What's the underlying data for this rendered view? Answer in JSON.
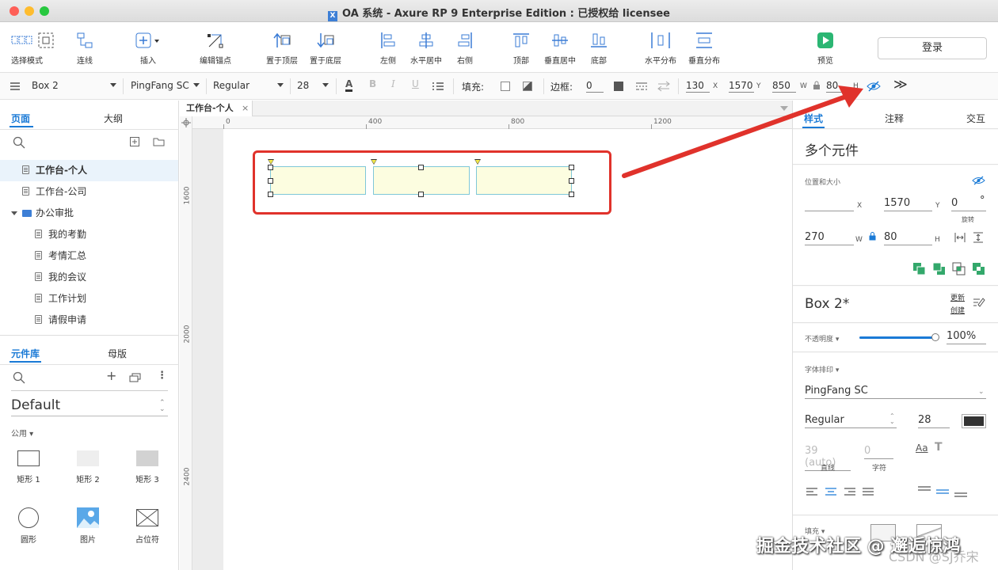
{
  "window": {
    "title": "OA 系统 - Axure RP 9 Enterprise Edition : 已授权给 licensee",
    "app_icon": "X"
  },
  "toolbar": {
    "tools": [
      {
        "label": "选择模式",
        "icon": "select-mode-icon"
      },
      {
        "label": "连线",
        "icon": "connector-icon"
      },
      {
        "label": "插入",
        "icon": "insert-icon"
      },
      {
        "label": "编辑锚点",
        "icon": "edit-anchor-icon"
      },
      {
        "label": "置于顶层",
        "icon": "bring-to-front-icon"
      },
      {
        "label": "置于底层",
        "icon": "send-to-back-icon"
      },
      {
        "label": "左侧",
        "icon": "align-left-icon"
      },
      {
        "label": "水平居中",
        "icon": "align-center-icon"
      },
      {
        "label": "右侧",
        "icon": "align-right-icon"
      },
      {
        "label": "顶部",
        "icon": "align-top-icon"
      },
      {
        "label": "垂直居中",
        "icon": "align-middle-icon"
      },
      {
        "label": "底部",
        "icon": "align-bottom-icon"
      },
      {
        "label": "水平分布",
        "icon": "distribute-horizontal-icon"
      },
      {
        "label": "垂直分布",
        "icon": "distribute-vertical-icon"
      },
      {
        "label": "预览",
        "icon": "preview-icon"
      }
    ],
    "login_label": "登录"
  },
  "format": {
    "widget_name": "Box 2",
    "font_family": "PingFang SC",
    "font_weight": "Regular",
    "font_size": "28",
    "fill_label": "填充:",
    "border_label": "边框:",
    "border_width": "0",
    "x": "130",
    "x_label": "X",
    "y": "1570",
    "y_label": "Y",
    "w": "850",
    "w_label": "W",
    "h": "80",
    "h_label": "H",
    "more": "≫"
  },
  "left": {
    "pages_tab": "页面",
    "outline_tab": "大纲",
    "pages": [
      {
        "label": "工作台-个人",
        "type": "page",
        "selected": true
      },
      {
        "label": "工作台-公司",
        "type": "page"
      },
      {
        "label": "办公审批",
        "type": "folder"
      },
      {
        "label": "我的考勤",
        "type": "page",
        "child": true
      },
      {
        "label": "考情汇总",
        "type": "page",
        "child": true
      },
      {
        "label": "我的会议",
        "type": "page",
        "child": true
      },
      {
        "label": "工作计划",
        "type": "page",
        "child": true
      },
      {
        "label": "请假申请",
        "type": "page",
        "child": true
      }
    ],
    "library_tab": "元件库",
    "masters_tab": "母版",
    "library_name": "Default",
    "group_label": "公用 ▾",
    "widgets": [
      {
        "label": "矩形 1",
        "icon": "rectangle-1-icon"
      },
      {
        "label": "矩形 2",
        "icon": "rectangle-2-icon"
      },
      {
        "label": "矩形 3",
        "icon": "rectangle-3-icon"
      },
      {
        "label": "圆形",
        "icon": "circle-icon"
      },
      {
        "label": "图片",
        "icon": "image-icon"
      },
      {
        "label": "占位符",
        "icon": "placeholder-icon"
      }
    ]
  },
  "canvas": {
    "tab_label": "工作台-个人",
    "ruler_h": [
      "0",
      "400",
      "800",
      "1200"
    ],
    "ruler_v": [
      "1600",
      "2000",
      "2400"
    ]
  },
  "right": {
    "tabs": [
      "样式",
      "注释",
      "交互"
    ],
    "header": "多个元件",
    "position_label": "位置和大小",
    "x_value": "",
    "x_label": "X",
    "y_value": "1570",
    "y_label": "Y",
    "rotation_value": "0",
    "rotation_unit": "°",
    "rotation_label": "旋转",
    "w_value": "270",
    "w_label": "W",
    "h_value": "80",
    "h_label": "H",
    "style_name": "Box 2*",
    "style_update": "更新",
    "style_create": "创建",
    "opacity_label": "不透明度 ▾",
    "opacity_value": "100%",
    "opacity_level": 1.0,
    "typography_label": "字体排印 ▾",
    "font_family": "PingFang SC",
    "font_weight": "Regular",
    "font_size": "28",
    "font_color": "#333333",
    "line_height_value": "39 (auto)",
    "line_height_label": "直线",
    "char_spacing_value": "0",
    "char_spacing_label": "字符",
    "fill_label": "填充 ▾"
  },
  "watermark": {
    "text": "掘金技术社区 @ 邂逅惊鸿",
    "sub": "CSDN @SJ乔宋"
  },
  "colors": {
    "accent": "#1a7ad6",
    "highlight": "#e0322b",
    "box_fill": "#fcfde0",
    "box_border": "#7fc7d8",
    "preview_green": "#2bb673",
    "stack_green": "#33a86b"
  }
}
